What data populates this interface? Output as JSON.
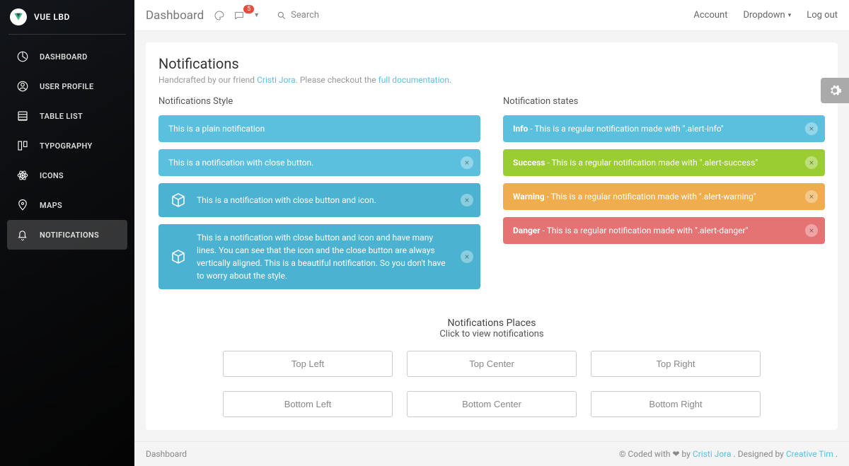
{
  "brand": {
    "name": "VUE LBD"
  },
  "sidebar": {
    "items": [
      {
        "label": "DASHBOARD"
      },
      {
        "label": "USER PROFILE"
      },
      {
        "label": "TABLE LIST"
      },
      {
        "label": "TYPOGRAPHY"
      },
      {
        "label": "ICONS"
      },
      {
        "label": "MAPS"
      },
      {
        "label": "NOTIFICATIONS"
      }
    ]
  },
  "topbar": {
    "title": "Dashboard",
    "badge": "5",
    "search": "Search",
    "account": "Account",
    "dropdown": "Dropdown",
    "logout": "Log out"
  },
  "page": {
    "title": "Notifications",
    "sub_prefix": "Handcrafted by our friend ",
    "sub_author": "Cristi Jora",
    "sub_middle": ". Please checkout the ",
    "sub_link": "full documentation",
    "sub_end": "."
  },
  "style_col": {
    "title": "Notifications Style",
    "alerts": [
      "This is a plain notification",
      "This is a notification with close button.",
      "This is a notification with close button and icon.",
      "This is a notification with close button and icon and have many lines. You can see that the icon and the close button are always vertically aligned. This is a beautiful notification. So you don't have to worry about the style."
    ]
  },
  "state_col": {
    "title": "Notification states",
    "info": {
      "label": "Info",
      "text": " - This is a regular notification made with \".alert-info\""
    },
    "success": {
      "label": "Success",
      "text": " - This is a regular notification made with \".alert-success\""
    },
    "warning": {
      "label": "Warning",
      "text": " - This is a regular notification made with \".alert-warning\""
    },
    "danger": {
      "label": "Danger",
      "text": " - This is a regular notification made with \".alert-danger\""
    }
  },
  "places": {
    "title": "Notifications Places",
    "sub": "Click to view notifications",
    "buttons": [
      "Top Left",
      "Top Center",
      "Top Right",
      "Bottom Left",
      "Bottom Center",
      "Bottom Right"
    ]
  },
  "footer": {
    "left": "Dashboard",
    "coded": "© Coded with",
    "by": "by",
    "author": "Cristi Jora",
    "designed": ". Designed by ",
    "designer": "Creative Tim",
    "end": "."
  }
}
